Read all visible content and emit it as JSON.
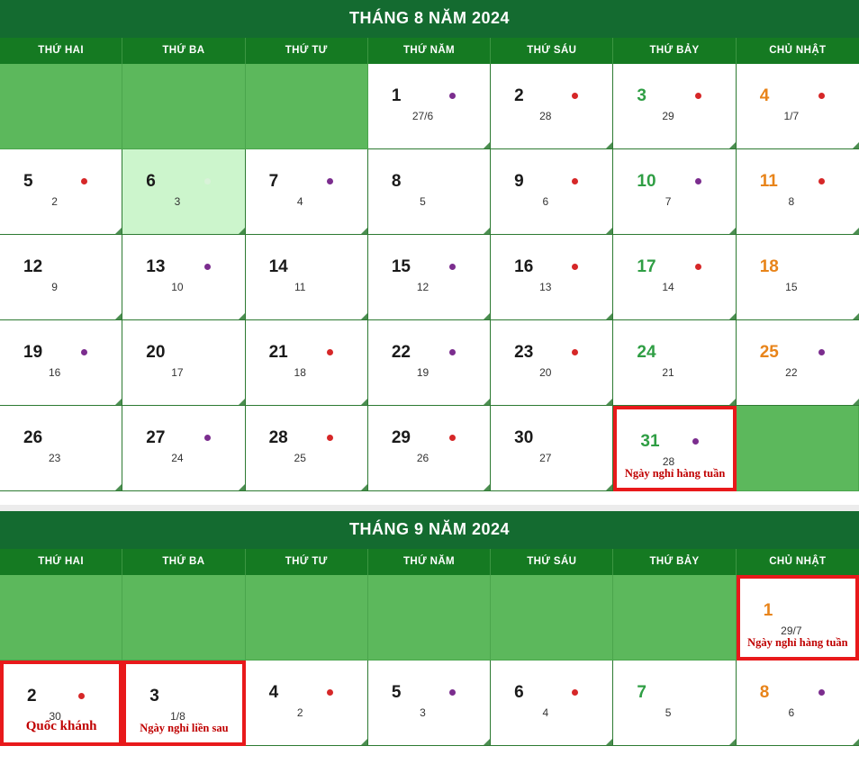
{
  "weekdays": [
    "THỨ HAI",
    "THỨ BA",
    "THỨ TƯ",
    "THỨ NĂM",
    "THỨ SÁU",
    "THỨ BẢY",
    "CHỦ NHẬT"
  ],
  "colors": {
    "header_green": "#146b30",
    "weekday_green": "#157a22",
    "blank_cell_green": "#5cb85c",
    "today_green": "#ccf5cc",
    "saturday_text": "#2f9e44",
    "sunday_text": "#e8841a",
    "marked_border_red": "#e8191b",
    "note_red": "#c00000",
    "dot_red": "#d62728",
    "dot_purple": "#7b2d8e",
    "page_background": "#ececec"
  },
  "months": [
    {
      "id": "august",
      "title": "THÁNG 8 NĂM 2024",
      "weeks": [
        [
          {
            "blank": true
          },
          {
            "blank": true
          },
          {
            "blank": true
          },
          {
            "day": "1",
            "lunar": "27/6",
            "dot": "purple",
            "type": "weekday"
          },
          {
            "day": "2",
            "lunar": "28",
            "dot": "red",
            "type": "weekday"
          },
          {
            "day": "3",
            "lunar": "29",
            "dot": "red",
            "type": "sat"
          },
          {
            "day": "4",
            "lunar": "1/7",
            "dot": "red",
            "type": "sun"
          }
        ],
        [
          {
            "day": "5",
            "lunar": "2",
            "dot": "red",
            "type": "weekday"
          },
          {
            "day": "6",
            "lunar": "3",
            "dot": "faint",
            "type": "weekday",
            "today": true
          },
          {
            "day": "7",
            "lunar": "4",
            "dot": "purple",
            "type": "weekday"
          },
          {
            "day": "8",
            "lunar": "5",
            "dot": "none",
            "type": "weekday"
          },
          {
            "day": "9",
            "lunar": "6",
            "dot": "red",
            "type": "weekday"
          },
          {
            "day": "10",
            "lunar": "7",
            "dot": "purple",
            "type": "sat"
          },
          {
            "day": "11",
            "lunar": "8",
            "dot": "red",
            "type": "sun"
          }
        ],
        [
          {
            "day": "12",
            "lunar": "9",
            "dot": "none",
            "type": "weekday"
          },
          {
            "day": "13",
            "lunar": "10",
            "dot": "purple",
            "type": "weekday"
          },
          {
            "day": "14",
            "lunar": "11",
            "dot": "none",
            "type": "weekday"
          },
          {
            "day": "15",
            "lunar": "12",
            "dot": "purple",
            "type": "weekday"
          },
          {
            "day": "16",
            "lunar": "13",
            "dot": "red",
            "type": "weekday"
          },
          {
            "day": "17",
            "lunar": "14",
            "dot": "red",
            "type": "sat"
          },
          {
            "day": "18",
            "lunar": "15",
            "dot": "none",
            "type": "sun"
          }
        ],
        [
          {
            "day": "19",
            "lunar": "16",
            "dot": "purple",
            "type": "weekday"
          },
          {
            "day": "20",
            "lunar": "17",
            "dot": "none",
            "type": "weekday"
          },
          {
            "day": "21",
            "lunar": "18",
            "dot": "red",
            "type": "weekday"
          },
          {
            "day": "22",
            "lunar": "19",
            "dot": "purple",
            "type": "weekday"
          },
          {
            "day": "23",
            "lunar": "20",
            "dot": "red",
            "type": "weekday"
          },
          {
            "day": "24",
            "lunar": "21",
            "dot": "none",
            "type": "sat"
          },
          {
            "day": "25",
            "lunar": "22",
            "dot": "purple",
            "type": "sun"
          }
        ],
        [
          {
            "day": "26",
            "lunar": "23",
            "dot": "none",
            "type": "weekday"
          },
          {
            "day": "27",
            "lunar": "24",
            "dot": "purple",
            "type": "weekday"
          },
          {
            "day": "28",
            "lunar": "25",
            "dot": "red",
            "type": "weekday"
          },
          {
            "day": "29",
            "lunar": "26",
            "dot": "red",
            "type": "weekday"
          },
          {
            "day": "30",
            "lunar": "27",
            "dot": "none",
            "type": "weekday"
          },
          {
            "day": "31",
            "lunar": "28",
            "dot": "purple",
            "type": "sat",
            "marked": true,
            "note": "Ngày nghỉ hàng tuần"
          },
          {
            "blank": true
          }
        ]
      ]
    },
    {
      "id": "september",
      "title": "THÁNG 9 NĂM 2024",
      "weeks": [
        [
          {
            "blank": true
          },
          {
            "blank": true
          },
          {
            "blank": true
          },
          {
            "blank": true
          },
          {
            "blank": true
          },
          {
            "blank": true
          },
          {
            "day": "1",
            "lunar": "29/7",
            "dot": "none",
            "type": "sun",
            "marked": true,
            "note": "Ngày nghỉ hàng tuần"
          }
        ],
        [
          {
            "day": "2",
            "lunar": "30",
            "dot": "red",
            "type": "weekday",
            "marked": true,
            "note": "Quốc khánh",
            "note_big": true
          },
          {
            "day": "3",
            "lunar": "1/8",
            "dot": "none",
            "type": "weekday",
            "marked": true,
            "note": "Ngày nghỉ liền sau"
          },
          {
            "day": "4",
            "lunar": "2",
            "dot": "red",
            "type": "weekday"
          },
          {
            "day": "5",
            "lunar": "3",
            "dot": "purple",
            "type": "weekday"
          },
          {
            "day": "6",
            "lunar": "4",
            "dot": "red",
            "type": "weekday"
          },
          {
            "day": "7",
            "lunar": "5",
            "dot": "none",
            "type": "sat"
          },
          {
            "day": "8",
            "lunar": "6",
            "dot": "purple",
            "type": "sun"
          }
        ]
      ]
    }
  ]
}
